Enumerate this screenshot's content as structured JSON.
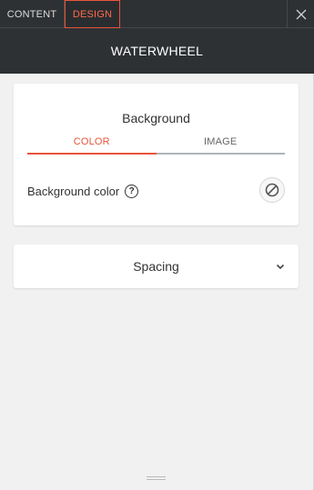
{
  "tabs": [
    {
      "label": "CONTENT",
      "active": false
    },
    {
      "label": "DESIGN",
      "active": true
    }
  ],
  "header": {
    "title": "WATERWHEEL"
  },
  "background_card": {
    "title": "Background",
    "subtabs": [
      {
        "label": "COLOR",
        "active": true
      },
      {
        "label": "IMAGE",
        "active": false
      }
    ],
    "color_row": {
      "label": "Background color",
      "help_icon": "question-circle-icon",
      "value_icon": "no-color-icon"
    }
  },
  "spacing_card": {
    "title": "Spacing",
    "icon": "chevron-down-icon",
    "expanded": false
  },
  "colors": {
    "accent": "#e8553a",
    "header_bg": "#2e3134",
    "panel_bg": "#f1f1f1"
  }
}
